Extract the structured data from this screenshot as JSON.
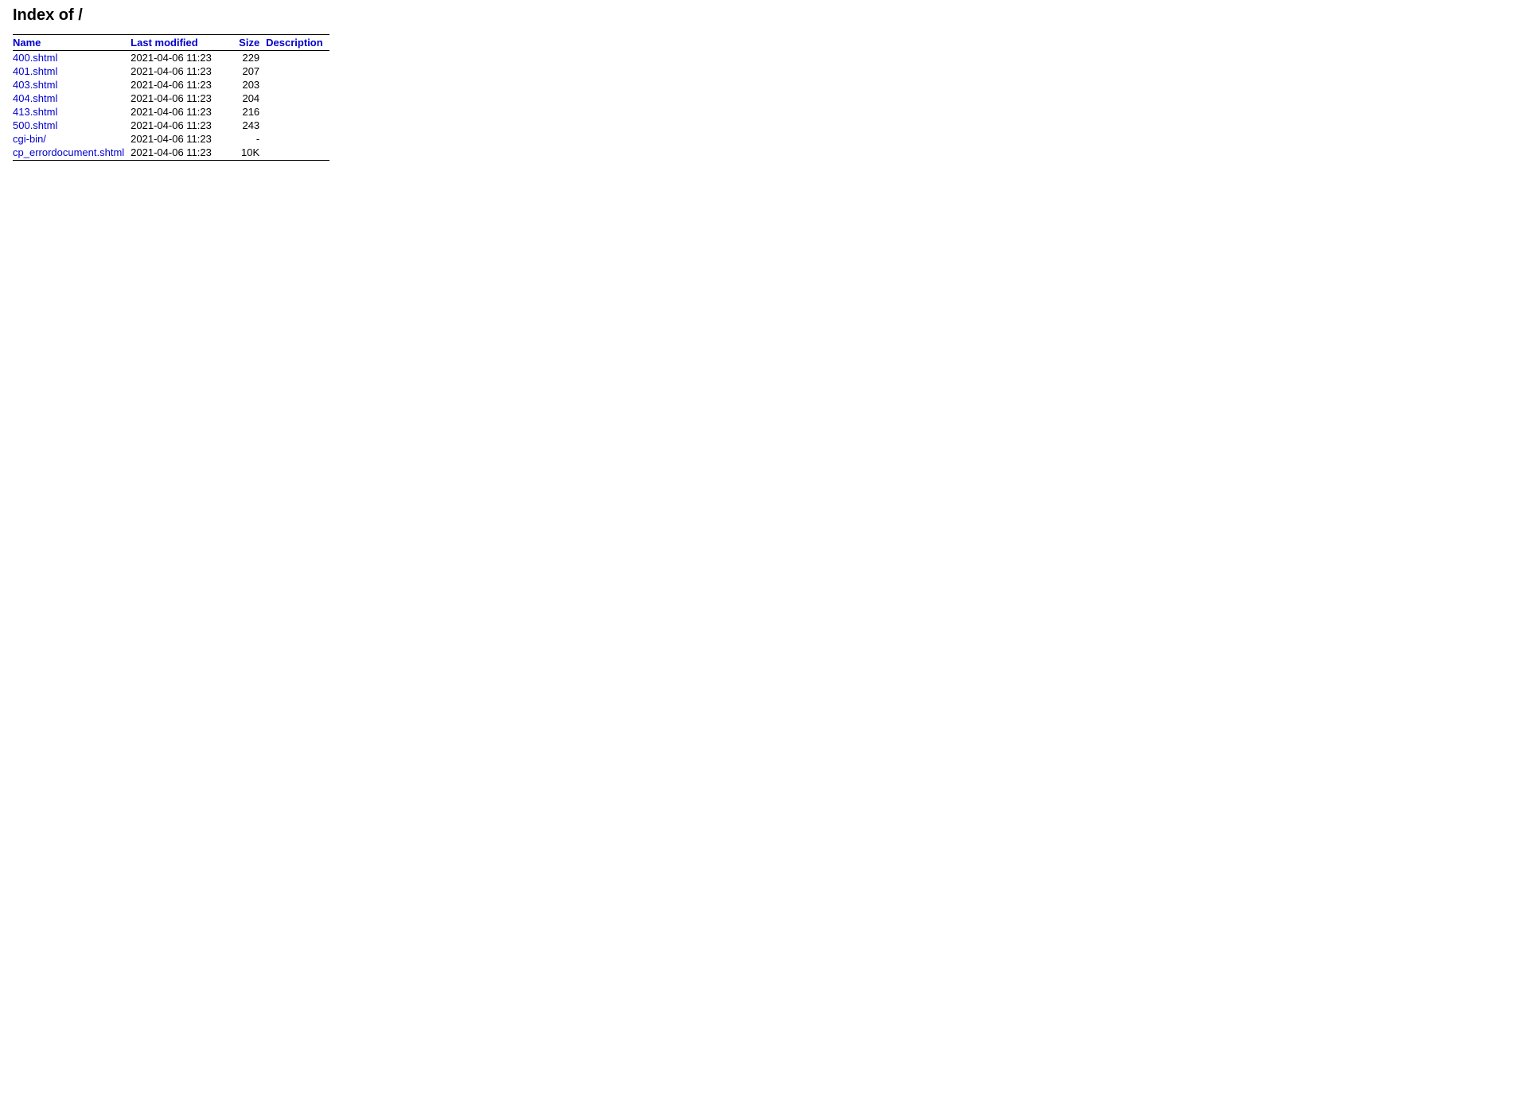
{
  "page": {
    "title": "Index of /",
    "columns": {
      "name": "Name",
      "last_modified": "Last modified",
      "size": "Size",
      "description": "Description"
    },
    "files": [
      {
        "name": "400.shtml",
        "href": "400.shtml",
        "modified": "2021-04-06 11:23",
        "size": "229",
        "description": ""
      },
      {
        "name": "401.shtml",
        "href": "401.shtml",
        "modified": "2021-04-06 11:23",
        "size": "207",
        "description": ""
      },
      {
        "name": "403.shtml",
        "href": "403.shtml",
        "modified": "2021-04-06 11:23",
        "size": "203",
        "description": ""
      },
      {
        "name": "404.shtml",
        "href": "404.shtml",
        "modified": "2021-04-06 11:23",
        "size": "204",
        "description": ""
      },
      {
        "name": "413.shtml",
        "href": "413.shtml",
        "modified": "2021-04-06 11:23",
        "size": "216",
        "description": ""
      },
      {
        "name": "500.shtml",
        "href": "500.shtml",
        "modified": "2021-04-06 11:23",
        "size": "243",
        "description": ""
      },
      {
        "name": "cgi-bin/",
        "href": "cgi-bin/",
        "modified": "2021-04-06 11:23",
        "size": "-",
        "description": ""
      },
      {
        "name": "cp_errordocument.shtml",
        "href": "cp_errordocument.shtml",
        "modified": "2021-04-06 11:23",
        "size": "10K",
        "description": ""
      }
    ]
  }
}
